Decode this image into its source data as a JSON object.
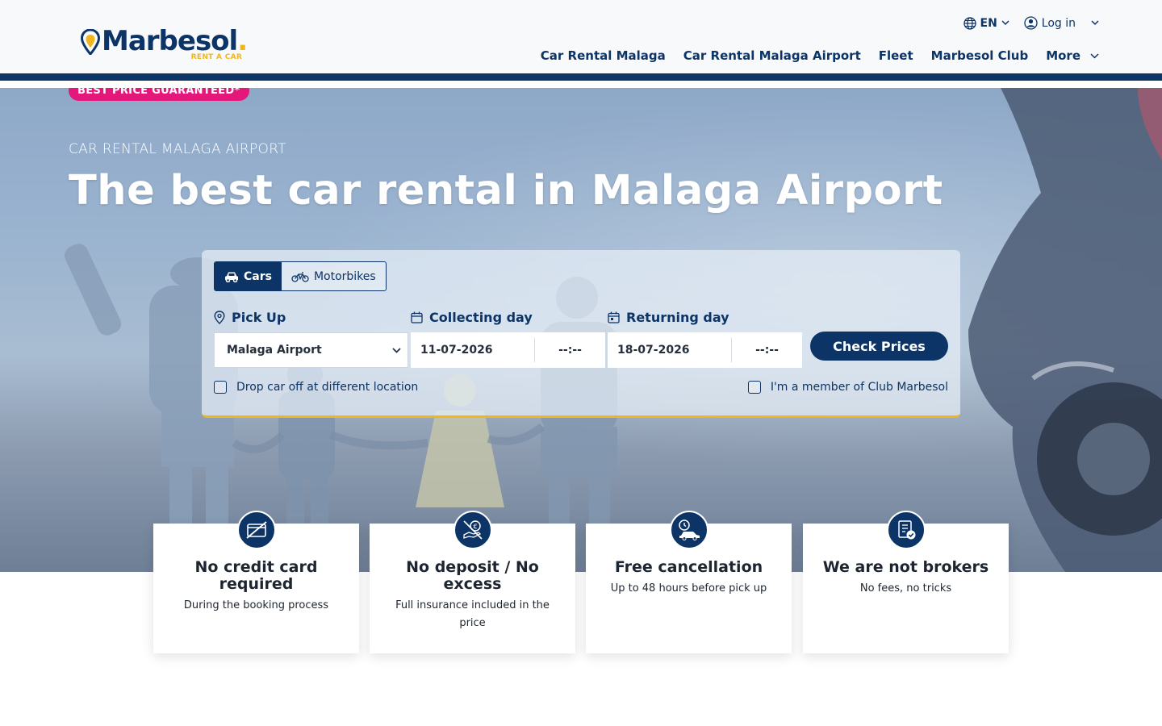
{
  "header": {
    "logo_text": "Marbesol",
    "logo_dot": ".",
    "logo_sub": "RENT A CAR",
    "language": "EN",
    "login": "Log in",
    "nav": [
      {
        "label": "Car Rental Malaga"
      },
      {
        "label": "Car Rental Malaga Airport"
      },
      {
        "label": "Fleet"
      },
      {
        "label": "Marbesol Club"
      },
      {
        "label": "More"
      }
    ]
  },
  "hero": {
    "badge": "BEST PRICE GUARANTEED*",
    "eyebrow": "CAR RENTAL MALAGA AIRPORT",
    "title": "The best car rental in Malaga Airport"
  },
  "booking": {
    "tabs": [
      {
        "label": "Cars",
        "active": true,
        "icon": "car-icon"
      },
      {
        "label": "Motorbikes",
        "active": false,
        "icon": "motorbike-icon"
      }
    ],
    "pickup_label": "Pick Up",
    "pickup_value": "Malaga Airport",
    "collecting_label": "Collecting day",
    "collecting_date": "11-07-2026",
    "collecting_time": "--:--",
    "returning_label": "Returning day",
    "returning_date": "18-07-2026",
    "returning_time": "--:--",
    "submit": "Check Prices",
    "dropoff_checkbox": "Drop car off at different location",
    "member_checkbox": "I'm a member of Club Marbesol"
  },
  "features": [
    {
      "title": "No credit card required",
      "subtitle": "During the booking process",
      "icon": "credit-card-crossed-icon"
    },
    {
      "title": "No deposit / No excess",
      "subtitle": "Full insurance included in the price",
      "icon": "no-deposit-icon"
    },
    {
      "title": "Free cancellation",
      "subtitle": "Up to 48 hours before pick up",
      "icon": "clock-car-icon"
    },
    {
      "title": "We are not brokers",
      "subtitle": "No fees, no tricks",
      "icon": "verified-document-icon"
    }
  ],
  "colors": {
    "brand_navy": "#0d3466",
    "accent_yellow": "#f2b51d",
    "badge_pink": "#e3187a"
  }
}
